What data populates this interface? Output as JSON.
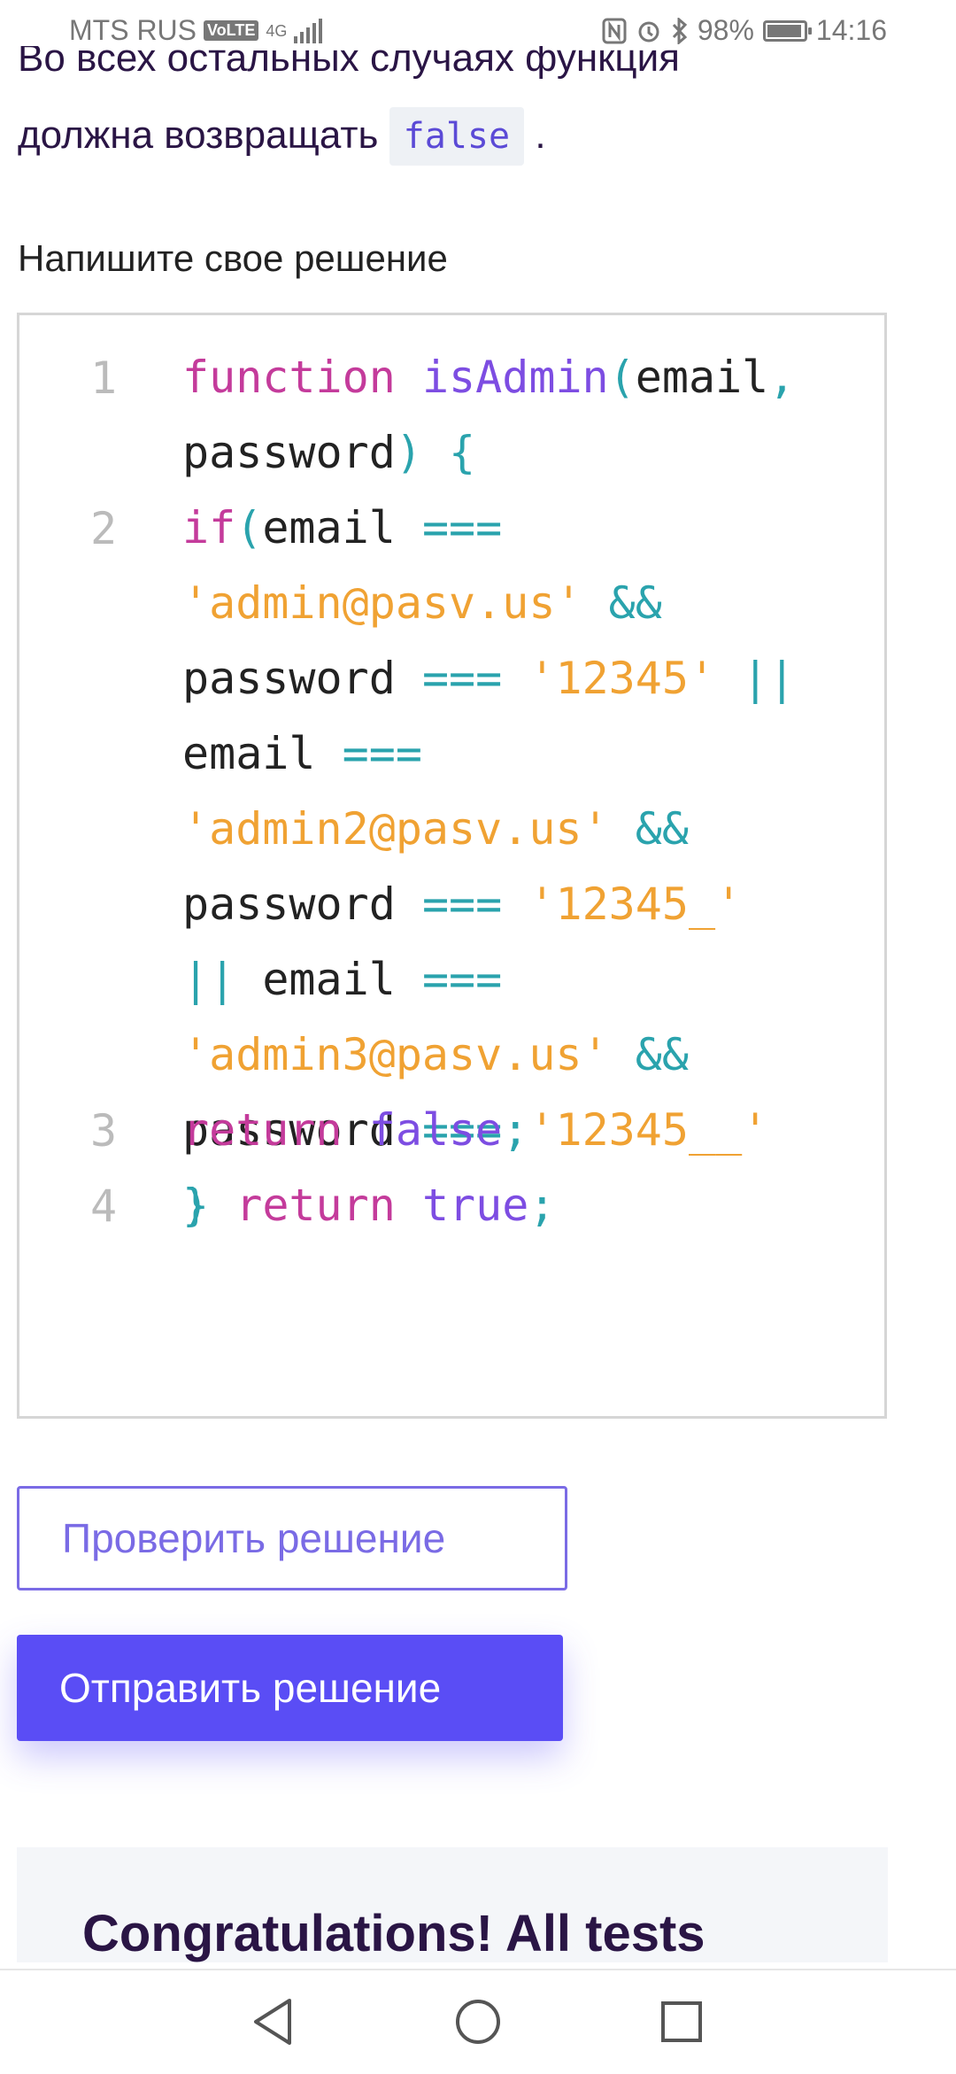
{
  "status_bar": {
    "carrier": "MTS RUS",
    "volte": "VoLTE",
    "network": "4G",
    "battery": "98%",
    "time": "14:16",
    "icons": [
      "nfc-icon",
      "alarm-icon",
      "bluetooth-icon",
      "battery-icon"
    ]
  },
  "task": {
    "line1": "Во всех остальных случаях функция",
    "line2_prefix": "должна возвращать",
    "inline_code": "false",
    "line2_suffix": "."
  },
  "solution_label": "Напишите свое решение",
  "code_editor": {
    "lines": [
      {
        "number": "1",
        "text": "function isAdmin(email, password) {"
      },
      {
        "number": "2",
        "text": "if(email === 'admin@pasv.us' && password === '12345' || email === 'admin2@pasv.us' && password === '12345_' || email === 'admin3@pasv.us' && password === '12345__' ) return true;"
      },
      {
        "number": "3",
        "text": "return false;"
      },
      {
        "number": "4",
        "text": "}"
      }
    ],
    "colors": {
      "keyword": "#c43b9b",
      "function": "#7d4de2",
      "operator": "#2aa3ad",
      "string": "#f0a233"
    }
  },
  "buttons": {
    "check_label": "Проверить решение",
    "submit_label": "Отправить решение"
  },
  "result": {
    "message": "Congratulations! All tests"
  },
  "nav_bar": {
    "icons": [
      "back-icon",
      "home-icon",
      "recent-apps-icon"
    ]
  },
  "colors": {
    "accent": "#5a4df5",
    "heading": "#2a1545"
  }
}
